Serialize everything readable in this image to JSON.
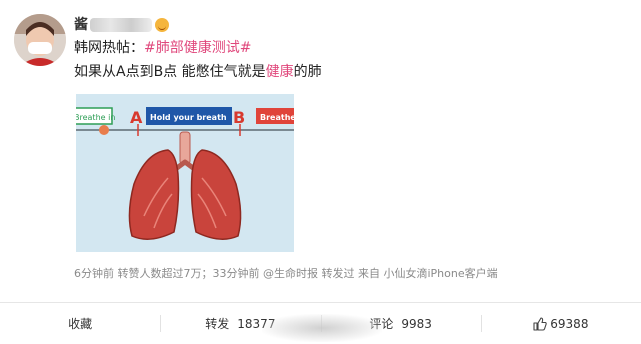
{
  "post": {
    "username_visible": "酱",
    "line1_prefix": "韩网热帖：",
    "hashtag": "#肺部健康测试#",
    "line2_before": "如果从A点到B点 能憋住气就是",
    "line2_highlight": "健康",
    "line2_after": "的肺",
    "image": {
      "left_label": "Breathe in",
      "mid_label": "Hold your breath",
      "right_label": "Breathe",
      "point_a": "A",
      "point_b": "B"
    },
    "meta": "6分钟前  转赞人数超过7万；33分钟前 @生命时报 转发过  来自 小仙女滴iPhone客户端"
  },
  "actions": {
    "collect_label": "收藏",
    "repost_label": "转发",
    "repost_count": "18377",
    "comment_label": "评论",
    "comment_count": "9983",
    "like_count": "69388"
  },
  "colors": {
    "hashtag": "#e0487c",
    "meta_text": "#8a8a8a",
    "arrow_blue": "#1f57a8",
    "arrow_red": "#e0443a",
    "lung_red": "#c9443c"
  },
  "icons": [
    "emoji-icon",
    "like-icon"
  ]
}
